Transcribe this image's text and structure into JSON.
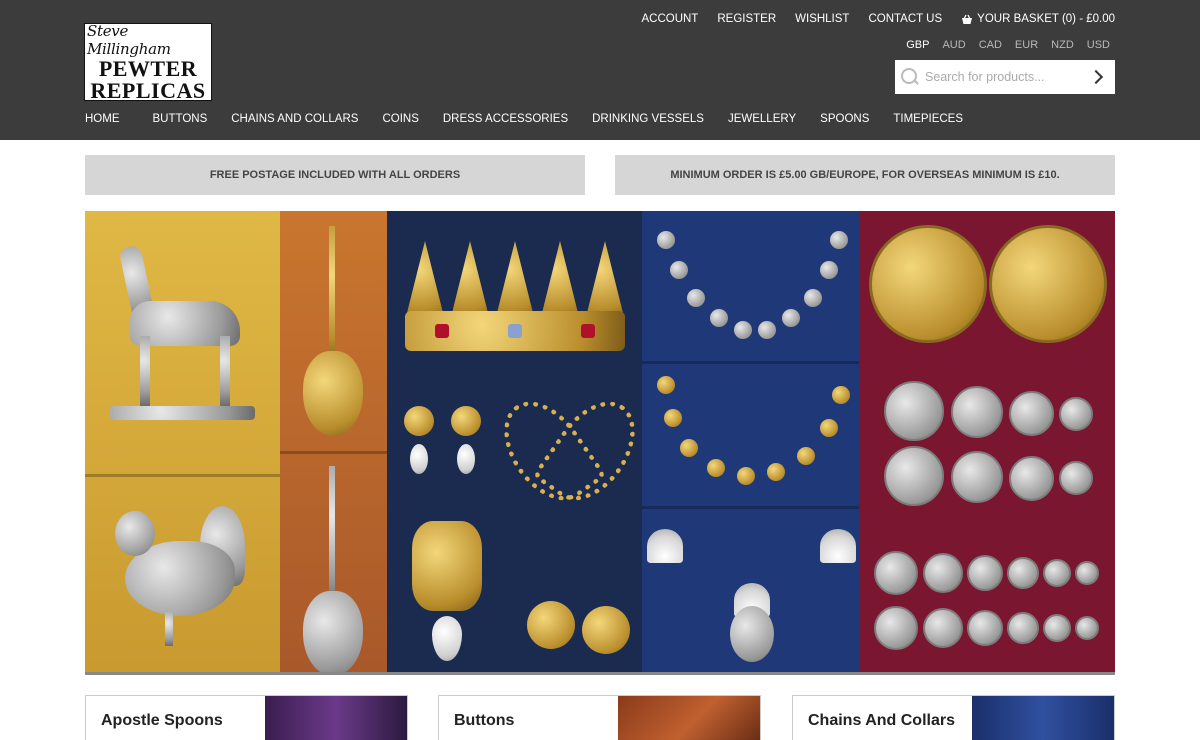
{
  "logo": {
    "line1": "Steve Millingham",
    "line2": "PEWTER",
    "line3": "REPLICAS"
  },
  "top_links": {
    "account": "ACCOUNT",
    "register": "REGISTER",
    "wishlist": "WISHLIST",
    "contact": "CONTACT US",
    "basket": "YOUR BASKET (0) - £0.00"
  },
  "currencies": [
    "GBP",
    "AUD",
    "CAD",
    "EUR",
    "NZD",
    "USD"
  ],
  "active_currency": "GBP",
  "search": {
    "placeholder": "Search for products..."
  },
  "nav": [
    "HOME",
    "BUTTONS",
    "CHAINS AND COLLARS",
    "COINS",
    "DRESS ACCESSORIES",
    "DRINKING VESSELS",
    "JEWELLERY",
    "SPOONS",
    "TIMEPIECES"
  ],
  "info_bars": {
    "postage": "FREE POSTAGE INCLUDED WITH ALL ORDERS",
    "minimum": "MINIMUM ORDER IS £5.00 GB/EUROPE, FOR OVERSEAS MINIMUM IS £10."
  },
  "categories": [
    {
      "title": "Apostle Spoons"
    },
    {
      "title": "Buttons"
    },
    {
      "title": "Chains And Collars"
    }
  ],
  "colors": {
    "header_bg": "#3c3c3c",
    "info_bg": "#d6d6d6",
    "inactive_currency": "#b9b9b9"
  }
}
